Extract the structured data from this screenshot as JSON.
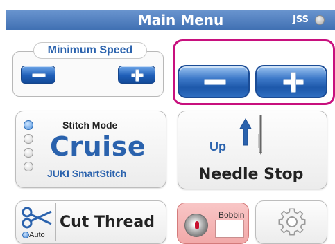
{
  "header": {
    "title": "Main Menu",
    "jss_label": "JSS"
  },
  "min_speed": {
    "label": "Minimum Speed",
    "decrease_icon": "minus-icon",
    "increase_icon": "plus-icon"
  },
  "speed": {
    "decrease_icon": "minus-icon",
    "increase_icon": "plus-icon"
  },
  "stitch": {
    "title": "Stitch Mode",
    "mode": "Cruise",
    "subtitle": "JUKI SmartStitch",
    "selected_index": 0,
    "options_count": 4
  },
  "needle": {
    "position": "Up",
    "label": "Needle Stop",
    "icon": "arrow-up-icon"
  },
  "cut_thread": {
    "label": "Cut Thread",
    "auto_label": "Auto",
    "icon": "scissors-icon"
  },
  "bobbin": {
    "label": "Bobbin",
    "icon": "bobbin-icon"
  },
  "settings": {
    "icon": "gear-icon"
  },
  "colors": {
    "accent": "#2a62ad",
    "highlight_border": "#c8107e",
    "bobbin_bg": "#f2a9a9"
  }
}
